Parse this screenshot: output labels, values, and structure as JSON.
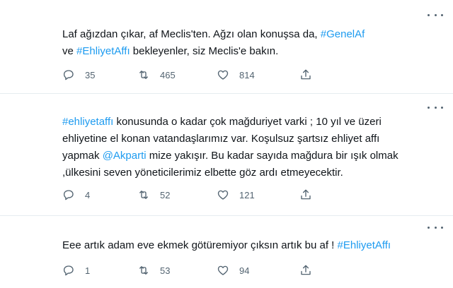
{
  "tweets": [
    {
      "segments": [
        {
          "t": "Laf ağızdan çıkar, af Meclis'ten. Ağzı olan konuşsa da, ",
          "link": false
        },
        {
          "t": "#GenelAf",
          "link": true
        },
        {
          "t": " ve ",
          "link": false
        },
        {
          "t": "#EhliyetAffı",
          "link": true
        },
        {
          "t": " bekleyenler, siz Meclis'e bakın.",
          "link": false
        }
      ],
      "replies": "35",
      "retweets": "465",
      "likes": "814"
    },
    {
      "segments": [
        {
          "t": "#ehliyetaffı",
          "link": true
        },
        {
          "t": " konusunda o kadar çok mağduriyet varki ; 10 yıl ve üzeri ehliyetine el konan vatandaşlarımız var. Koşulsuz şartsız ehliyet affı yapmak ",
          "link": false
        },
        {
          "t": "@Akparti",
          "link": true
        },
        {
          "t": " mize yakışır. Bu kadar sayıda mağdura bir ışık olmak ,ülkesini seven yöneticilerimiz elbette göz ardı etmeyecektir.",
          "link": false
        }
      ],
      "replies": "4",
      "retweets": "52",
      "likes": "121"
    },
    {
      "segments": [
        {
          "t": "Eee artık adam eve ekmek götüremiyor çıksın artık bu af ! ",
          "link": false
        },
        {
          "t": "#EhliyetAffı",
          "link": true
        }
      ],
      "replies": "1",
      "retweets": "53",
      "likes": "94"
    }
  ],
  "icons": {
    "more": "more-dots-icon",
    "reply": "reply-icon",
    "retweet": "retweet-icon",
    "like": "heart-icon",
    "share": "share-icon"
  },
  "colors": {
    "link": "#1d9bf0",
    "text": "#0f1419",
    "secondary": "#536471",
    "divider": "#e6ecf0"
  }
}
